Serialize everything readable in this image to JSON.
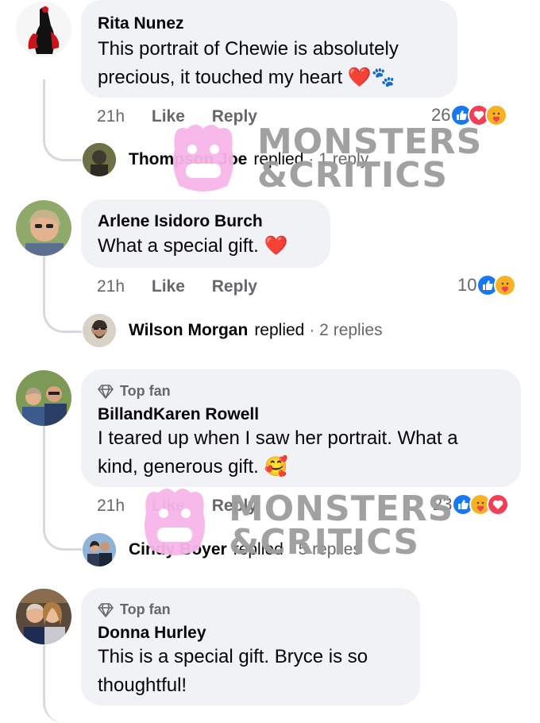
{
  "comments": [
    {
      "name": "Rita Nunez",
      "text_line1": "This portrait of Chewie is absolutely",
      "text_line2": "precious, it touched my heart",
      "emoji": "❤️🐾",
      "time": "21h",
      "like": "Like",
      "reply": "Reply",
      "reaction_count": "26",
      "reactions": [
        "like-icon",
        "love-icon",
        "care-icon"
      ],
      "replies": {
        "name": "Thompson Joe",
        "verb": "replied",
        "count": "· 1 reply"
      }
    },
    {
      "name": "Arlene Isidoro Burch",
      "text_line1": "What a special gift.",
      "emoji": "❤️",
      "time": "21h",
      "like": "Like",
      "reply": "Reply",
      "reaction_count": "10",
      "reactions": [
        "like-icon",
        "care-icon"
      ],
      "replies": {
        "name": "Wilson Morgan",
        "verb": "replied",
        "count": "· 2 replies"
      }
    },
    {
      "badge": "Top fan",
      "name": "BillandKaren Rowell",
      "text_line1": "I teared up when I saw her portrait.  What a",
      "text_line2": "kind, generous gift.",
      "emoji": "🥰",
      "time": "21h",
      "like": "Like",
      "reply": "Reply",
      "reaction_count": "23",
      "reactions": [
        "like-icon",
        "care-icon",
        "love-icon"
      ],
      "replies": {
        "name": "Cindy Boyer",
        "verb": "replied",
        "count": "· 5 replies"
      }
    },
    {
      "badge": "Top fan",
      "name": "Donna Hurley",
      "text_line1": "This is a special gift.  Bryce is so",
      "text_line2": "thoughtful!"
    }
  ],
  "watermark": {
    "line1": "MONSTERS",
    "line2": "&CRITICS"
  },
  "colors": {
    "like": "#1877f2",
    "love": "#f33e58",
    "care": "#f7b125",
    "bubble": "#f0f2f5",
    "muted": "#65676b"
  }
}
